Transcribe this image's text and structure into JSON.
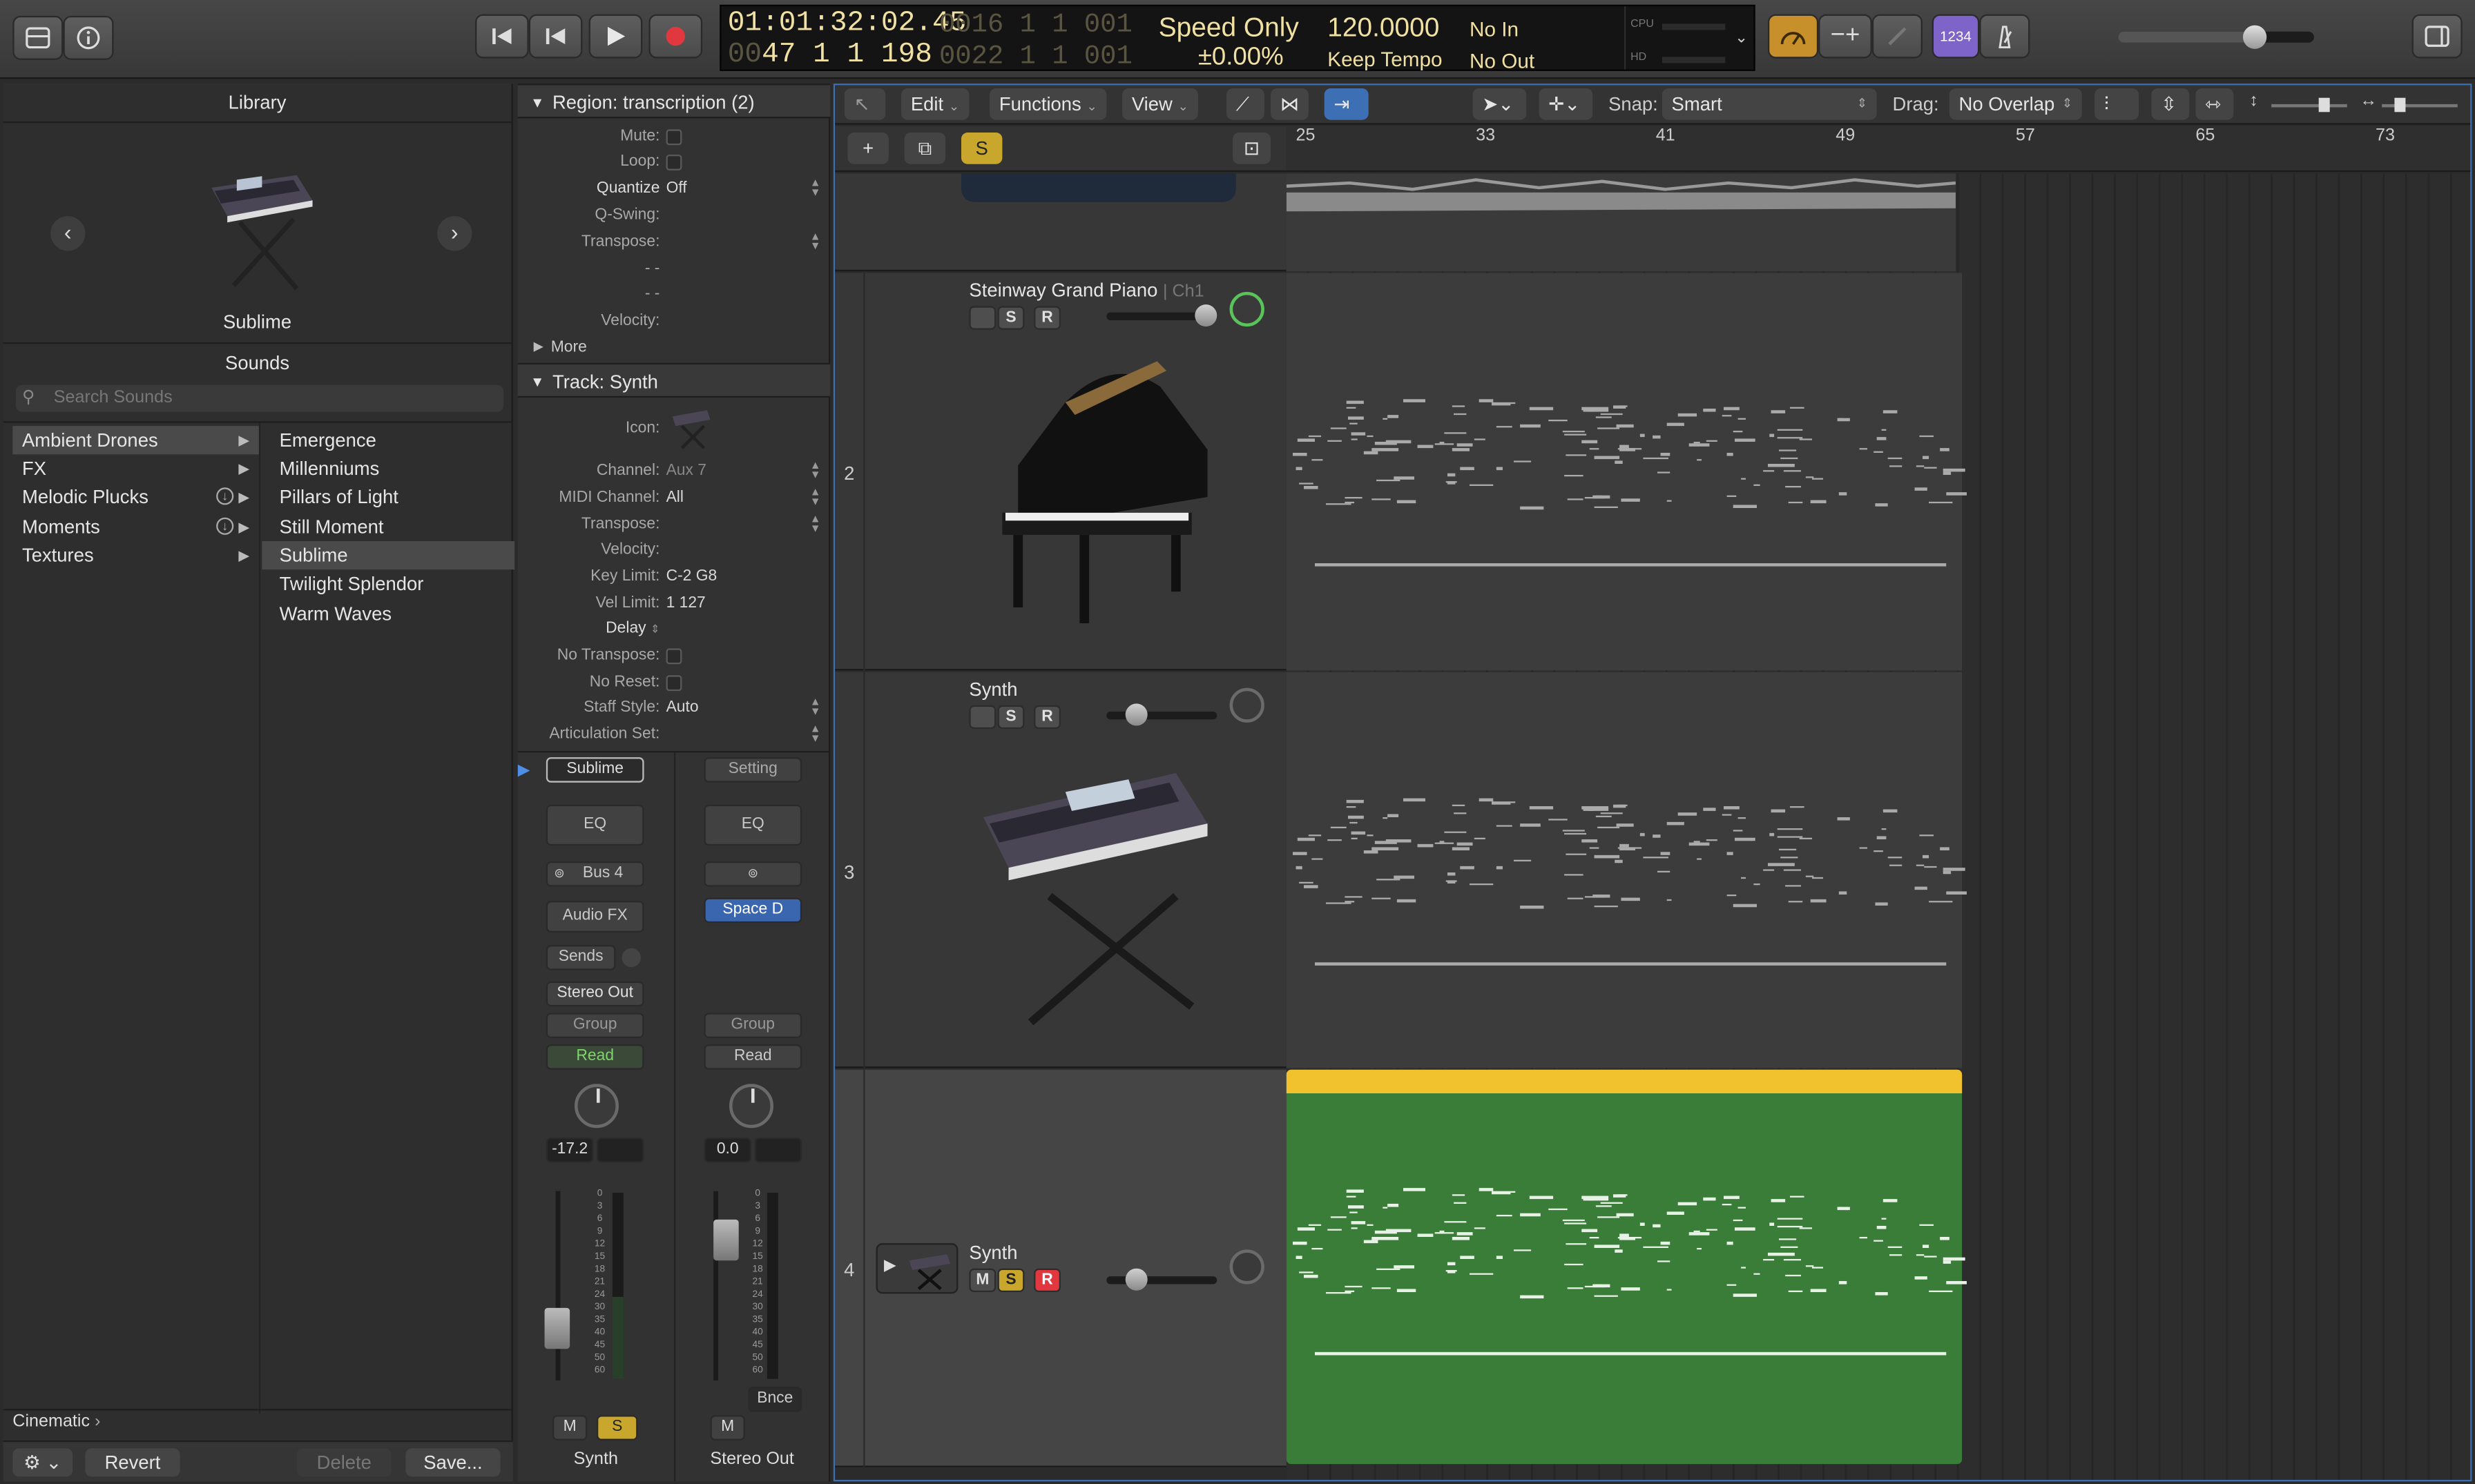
{
  "transport": {
    "position_time": "01:01:32:02.45",
    "position_bars": "47  1  1  198",
    "end_time": "0016  1  1  001",
    "end_bars": "0022  1  1  001",
    "mode": "Speed Only",
    "mode_value": "±0.00%",
    "tempo": "120.0000",
    "tempo_mode": "Keep Tempo",
    "in": "No In",
    "out": "No Out",
    "cpu": "CPU",
    "hd": "HD",
    "count_in": "1234"
  },
  "library": {
    "title": "Library",
    "patch_name": "Sublime",
    "sounds_header": "Sounds",
    "search_placeholder": "Search Sounds",
    "categories": [
      "Ambient Drones",
      "FX",
      "Melodic Plucks",
      "Moments",
      "Textures"
    ],
    "patches": [
      "Emergence",
      "Millenniums",
      "Pillars of Light",
      "Still Moment",
      "Sublime",
      "Twilight Splendor",
      "Warm Waves"
    ],
    "path": "Cinematic",
    "revert": "Revert",
    "delete": "Delete",
    "save": "Save..."
  },
  "inspector": {
    "region_title": "Region: transcription (2)",
    "mute": "Mute:",
    "loop": "Loop:",
    "quantize": "Quantize",
    "quantize_value": "Off",
    "qswing": "Q-Swing:",
    "transpose": "Transpose:",
    "dashes1": "- -",
    "dashes2": "- -",
    "velocity": "Velocity:",
    "more": "More",
    "track_title": "Track:  Synth",
    "icon": "Icon:",
    "channel": "Channel:",
    "channel_value": "Aux 7",
    "midi_channel": "MIDI Channel:",
    "midi_channel_value": "All",
    "transpose2": "Transpose:",
    "velocity2": "Velocity:",
    "key_limit": "Key Limit:",
    "key_limit_value": "C-2  G8",
    "vel_limit": "Vel Limit:",
    "vel_limit_value": "1  127",
    "delay": "Delay",
    "no_transpose": "No Transpose:",
    "no_reset": "No Reset:",
    "staff_style": "Staff Style:",
    "staff_style_value": "Auto",
    "articulation": "Articulation Set:"
  },
  "strips": {
    "left": {
      "setting": "Sublime",
      "eq": "EQ",
      "bus": "Bus 4",
      "audio_fx": "Audio FX",
      "sends": "Sends",
      "output": "Stereo Out",
      "group": "Group",
      "automation": "Read",
      "value": "-17.2",
      "m": "M",
      "s": "S",
      "name": "Synth"
    },
    "right": {
      "setting": "Setting",
      "eq": "EQ",
      "fx": "Space D",
      "group": "Group",
      "automation": "Read",
      "value": "0.0",
      "bounce": "Bnce",
      "m": "M",
      "name": "Stereo Out"
    },
    "scale": [
      "0",
      "3",
      "6",
      "9",
      "12",
      "15",
      "18",
      "21",
      "24",
      "30",
      "35",
      "40",
      "45",
      "50",
      "60"
    ]
  },
  "toolbar": {
    "edit": "Edit",
    "functions": "Functions",
    "view": "View",
    "snap_label": "Snap:",
    "snap_value": "Smart",
    "drag_label": "Drag:",
    "drag_value": "No Overlap",
    "s_button": "S"
  },
  "ruler": [
    "25",
    "33",
    "41",
    "49",
    "57",
    "65",
    "73"
  ],
  "tracks": [
    {
      "number": "2",
      "name": "Steinway Grand Piano",
      "channel": "Ch1",
      "s": "S",
      "r": "R"
    },
    {
      "number": "3",
      "name": "Synth",
      "s": "S",
      "r": "R"
    },
    {
      "number": "4",
      "name": "Synth",
      "m": "M",
      "s": "S",
      "r": "R"
    }
  ],
  "colors": {
    "accent": "#3c6fb4",
    "region_green": "#3a7d38",
    "region_yellow": "#f2c12e",
    "lcd_text": "#f0e1a2",
    "record": "#e0383e",
    "solo": "#c9a62c"
  }
}
